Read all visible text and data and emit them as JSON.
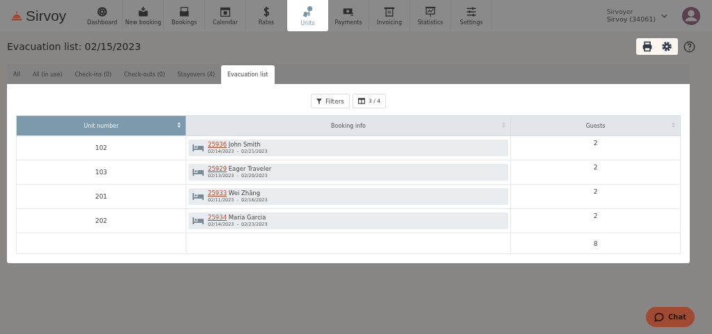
{
  "brand": {
    "name": "Sirvoy"
  },
  "nav": [
    {
      "label": "Dashboard",
      "selected": false
    },
    {
      "label": "New booking",
      "selected": false
    },
    {
      "label": "Bookings",
      "selected": false
    },
    {
      "label": "Calendar",
      "selected": false
    },
    {
      "label": "Rates",
      "selected": false
    },
    {
      "label": "Units",
      "selected": true
    },
    {
      "label": "Payments",
      "selected": false
    },
    {
      "label": "Invoicing",
      "selected": false
    },
    {
      "label": "Statistics",
      "selected": false
    },
    {
      "label": "Settings",
      "selected": false
    }
  ],
  "user": {
    "role": "Sirvoyer",
    "account": "Sirvoy (34061)"
  },
  "page": {
    "title": "Evacuation list: 02/15/2023"
  },
  "tabs": [
    {
      "label": "All",
      "selected": false
    },
    {
      "label": "All (in use)",
      "selected": false
    },
    {
      "label": "Check-ins (0)",
      "selected": false
    },
    {
      "label": "Check-outs (0)",
      "selected": false
    },
    {
      "label": "Stayovers (4)",
      "selected": false
    },
    {
      "label": "Evacuation list",
      "selected": true
    }
  ],
  "toolbar": {
    "filters": "Filters",
    "columns": "3 / 4"
  },
  "table": {
    "columns": [
      {
        "label": "Unit number",
        "sorted": true
      },
      {
        "label": "Booking info",
        "sorted": false
      },
      {
        "label": "Guests",
        "sorted": false
      }
    ],
    "rows": [
      {
        "unit": "102",
        "booking_id": "25936",
        "guest": "John Smith",
        "dates": "02/14/2023  -  02/21/2023",
        "guests": "2"
      },
      {
        "unit": "103",
        "booking_id": "25929",
        "guest": "Eager Traveler",
        "dates": "02/13/2023  -  02/20/2023",
        "guests": "2"
      },
      {
        "unit": "201",
        "booking_id": "25933",
        "guest": "Wei Zhāng",
        "dates": "02/11/2023  -  02/16/2023",
        "guests": "2"
      },
      {
        "unit": "202",
        "booking_id": "25934",
        "guest": "Maria Garcia",
        "dates": "02/14/2023  -  02/23/2023",
        "guests": "2"
      }
    ],
    "total": {
      "guests": "8"
    }
  },
  "chat": {
    "label": "Chat"
  }
}
